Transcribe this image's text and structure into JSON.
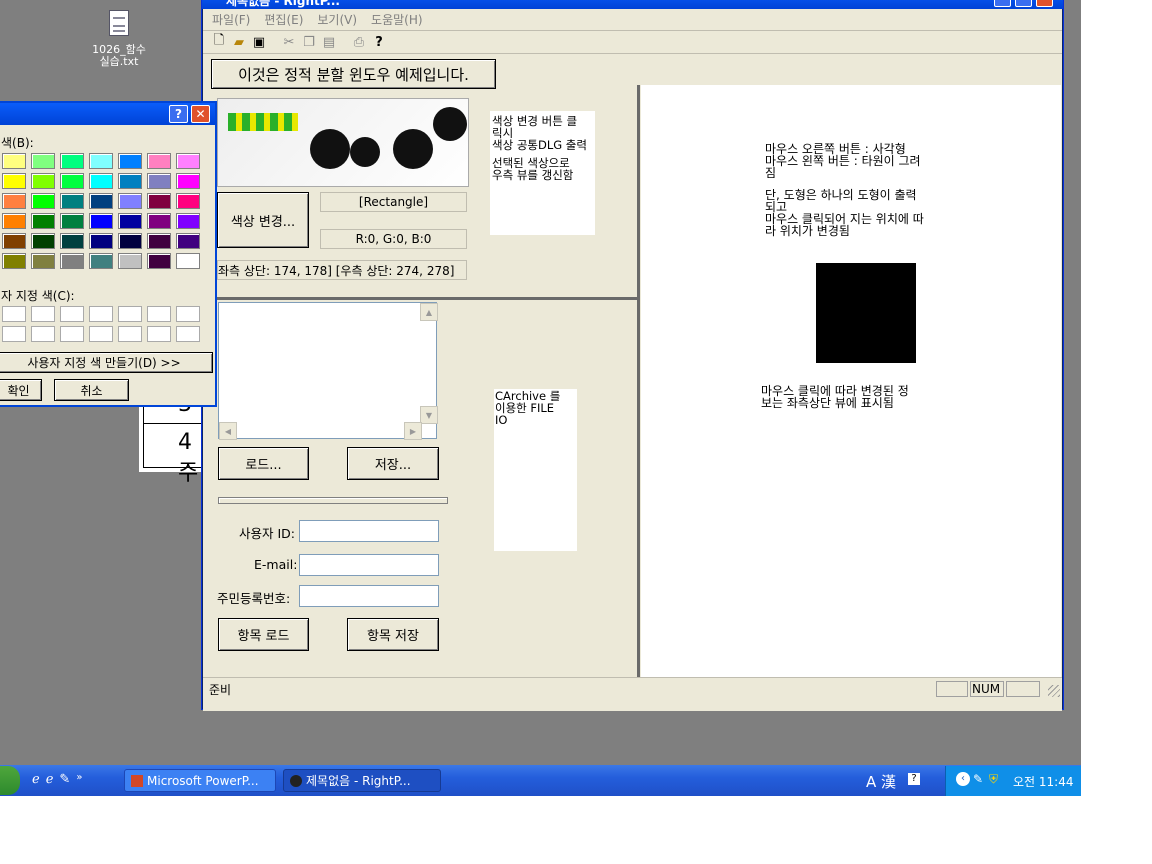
{
  "desktop": {
    "icon_label_1": "1026_함수",
    "icon_label_2": "실습.txt"
  },
  "window": {
    "title": "제목없음 - RightP..."
  },
  "menu": {
    "file": "파일(F)",
    "edit": "편집(E)",
    "view": "보기(V)",
    "help": "도움말(H)"
  },
  "header_button": "이것은 정적 분할 윈도우 예제입니다.",
  "top_left": {
    "color_change_button": "색상 변경...",
    "shape_label": "[Rectangle]",
    "rgb_label": "R:0, G:0, B:0",
    "coords_label": "좌측 상단: 174, 178]  [우측 상단: 274, 278]",
    "note": [
      "색상 변경 버튼 클",
      "릭시",
      "색상 공통DLG 출력",
      "",
      "선택된 색상으로",
      "우측 뷰를 갱신함"
    ]
  },
  "bottom_left": {
    "load_button": "로드...",
    "save_button": "저장...",
    "user_id_label": "사용자 ID:",
    "email_label": "E-mail:",
    "rrn_label": "주민등록번호:",
    "item_load_button": "항목 로드",
    "item_save_button": "항목 저장",
    "note": [
      "CArchive 를",
      "이용한 FILE",
      "IO"
    ]
  },
  "right_view": {
    "note1": [
      "마우스 오른쪽 버튼 : 사각형",
      "마우스 왼쪽 버튼 : 타원이 그려",
      "짐",
      "",
      "단, 도형은 하나의 도형이 출력",
      "되고",
      "마우스 클릭되어 지는 위치에 따",
      "라 위치가 변경됨"
    ],
    "note2": [
      "마우스 클릭에 따라 변경된 정",
      "보는 좌측상단 뷰에 표시됨"
    ],
    "shape_color": "#000000"
  },
  "statusbar": {
    "ready": "준비",
    "num": "NUM"
  },
  "color_dialog": {
    "basic_label": "색(B):",
    "custom_label": "자 지정 색(C):",
    "define_custom_button": "사용자 지정 색 만들기(D) >>",
    "ok_button": "확인",
    "cancel_button": "취소",
    "colors": [
      [
        "#ffff80",
        "#80ff80",
        "#00ff80",
        "#80ffff",
        "#0080ff",
        "#ff80c0",
        "#ff80ff"
      ],
      [
        "#ffff00",
        "#80ff00",
        "#00ff40",
        "#00ffff",
        "#0080c0",
        "#8080c0",
        "#ff00ff"
      ],
      [
        "#ff8040",
        "#00ff00",
        "#008080",
        "#004080",
        "#8080ff",
        "#800040",
        "#ff0080"
      ],
      [
        "#ff8000",
        "#008000",
        "#008040",
        "#0000ff",
        "#0000a0",
        "#800080",
        "#8000ff"
      ],
      [
        "#804000",
        "#004000",
        "#004040",
        "#000080",
        "#000040",
        "#400040",
        "#400080"
      ],
      [
        "#808000",
        "#808040",
        "#808080",
        "#408080",
        "#c0c0c0",
        "#400040",
        "#ffffff"
      ]
    ]
  },
  "background_table": {
    "cell1": "3",
    "cell2": "4주"
  },
  "taskbar": {
    "powerpoint": "Microsoft PowerP...",
    "app": "제목없음 - RightP...",
    "ime": "A 漢",
    "clock": "오전 11:44"
  }
}
